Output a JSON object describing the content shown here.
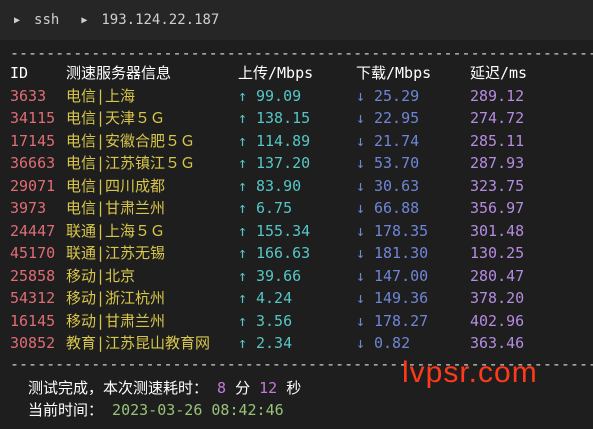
{
  "titlebar": {
    "segments": [
      "ssh",
      "193.124.22.187"
    ]
  },
  "table": {
    "rule": "------------------------------------------------------------------------------------------------------",
    "headers": {
      "id": "ID",
      "name": "测速服务器信息",
      "upload": "上传/Mbps",
      "download": "下载/Mbps",
      "latency": "延迟/ms"
    },
    "rows": [
      {
        "id": "3633",
        "name": "电信|上海",
        "up": "99.09",
        "down": "25.29",
        "lat": "289.12"
      },
      {
        "id": "34115",
        "name": "电信|天津５Ｇ",
        "up": "138.15",
        "down": "22.95",
        "lat": "274.72"
      },
      {
        "id": "17145",
        "name": "电信|安徽合肥５Ｇ",
        "up": "114.89",
        "down": "21.74",
        "lat": "285.11"
      },
      {
        "id": "36663",
        "name": "电信|江苏镇江５Ｇ",
        "up": "137.20",
        "down": "53.70",
        "lat": "287.93"
      },
      {
        "id": "29071",
        "name": "电信|四川成都",
        "up": "83.90",
        "down": "30.63",
        "lat": "323.75"
      },
      {
        "id": "3973",
        "name": "电信|甘肃兰州",
        "up": "6.75",
        "down": "66.88",
        "lat": "356.97"
      },
      {
        "id": "24447",
        "name": "联通|上海５Ｇ",
        "up": "155.34",
        "down": "178.35",
        "lat": "301.48"
      },
      {
        "id": "45170",
        "name": "联通|江苏无锡",
        "up": "166.63",
        "down": "181.30",
        "lat": "130.25"
      },
      {
        "id": "25858",
        "name": "移动|北京",
        "up": "39.66",
        "down": "147.00",
        "lat": "280.47"
      },
      {
        "id": "54312",
        "name": "移动|浙江杭州",
        "up": "4.24",
        "down": "149.36",
        "lat": "378.20"
      },
      {
        "id": "16145",
        "name": "移动|甘肃兰州",
        "up": "3.56",
        "down": "178.27",
        "lat": "402.96"
      },
      {
        "id": "30852",
        "name": "教育|江苏昆山教育网",
        "up": "2.34",
        "down": "0.82",
        "lat": "363.46"
      }
    ],
    "up_arrow": "↑",
    "down_arrow": "↓"
  },
  "summary": {
    "finished_prefix": "测试完成，本次测速耗时：",
    "minutes": "8",
    "minutes_unit": "分",
    "seconds": "12",
    "seconds_unit": "秒",
    "time_label": "当前时间：",
    "datetime": "2023-03-26 08:42:46"
  },
  "watermark": "lvpsr.com"
}
